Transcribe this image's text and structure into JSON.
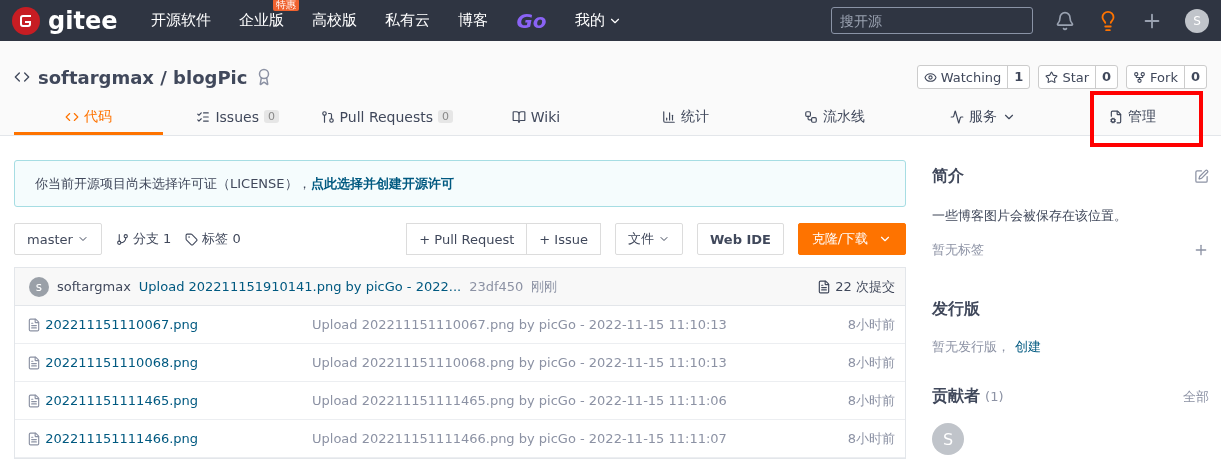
{
  "nav": {
    "logo": "gitee",
    "items": [
      {
        "label": "开源软件",
        "kind": "link"
      },
      {
        "label": "企业版",
        "kind": "link",
        "badge": "特惠"
      },
      {
        "label": "高校版",
        "kind": "link"
      },
      {
        "label": "私有云",
        "kind": "link"
      },
      {
        "label": "博客",
        "kind": "link"
      },
      {
        "label": "Go",
        "kind": "brand"
      },
      {
        "label": "我的",
        "kind": "menu"
      }
    ],
    "search": {
      "placeholder": "搜开源"
    },
    "avatar": "S"
  },
  "repo": {
    "owner": "softargmax",
    "separator": "/",
    "name": "blogPic",
    "actions": [
      {
        "label": "Watching",
        "count": "1",
        "kind": "watch"
      },
      {
        "label": "Star",
        "count": "0",
        "kind": "star"
      },
      {
        "label": "Fork",
        "count": "0",
        "kind": "fork"
      }
    ]
  },
  "tabs": [
    {
      "label": "代码",
      "selected": true,
      "highlighted": false
    },
    {
      "label": "Issues",
      "count": "0",
      "selected": false,
      "highlighted": false
    },
    {
      "label": "Pull Requests",
      "count": "0",
      "selected": false,
      "highlighted": false
    },
    {
      "label": "Wiki",
      "selected": false,
      "highlighted": false
    },
    {
      "label": "统计",
      "selected": false,
      "highlighted": false
    },
    {
      "label": "流水线",
      "selected": false,
      "highlighted": false
    },
    {
      "label": "服务",
      "menu": true,
      "selected": false,
      "highlighted": false
    },
    {
      "label": "管理",
      "selected": false,
      "highlighted": true
    }
  ],
  "notice": {
    "text": "你当前开源项目尚未选择许可证（LICENSE），",
    "link": "点此选择并创建开源许可"
  },
  "toolbar": {
    "branch": "master",
    "branches": "分支 1",
    "tags": "标签 0",
    "pr_buttons": [
      "+ Pull Request",
      "+ Issue"
    ],
    "file_menu": "文件",
    "web_ide": "Web IDE",
    "clone": "克隆/下载"
  },
  "latest_commit": {
    "avatar": "s",
    "author": "softargmax",
    "message": "Upload 202211151910141.png by picGo - 2022...",
    "hash": "23df450",
    "time": "刚刚",
    "commits": "22 次提交"
  },
  "files": [
    {
      "name": "202211151110067.png",
      "message": "Upload 202211151110067.png by picGo - 2022-11-15 11:10:13",
      "time": "8小时前"
    },
    {
      "name": "202211151110068.png",
      "message": "Upload 202211151110068.png by picGo - 2022-11-15 11:10:13",
      "time": "8小时前"
    },
    {
      "name": "202211151111465.png",
      "message": "Upload 202211151111465.png by picGo - 2022-11-15 11:11:06",
      "time": "8小时前"
    },
    {
      "name": "202211151111466.png",
      "message": "Upload 202211151111466.png by picGo - 2022-11-15 11:11:07",
      "time": "8小时前"
    }
  ],
  "sidebar": {
    "about": {
      "title": "简介",
      "description": "一些博客图片会被保存在该位置。",
      "tags_empty": "暂无标签"
    },
    "releases": {
      "title": "发行版",
      "empty": "暂无发行版，",
      "link": "创建"
    },
    "contributors": {
      "title": "贡献者",
      "count": "(1)",
      "all": "全部",
      "avatars": [
        "S"
      ]
    }
  }
}
